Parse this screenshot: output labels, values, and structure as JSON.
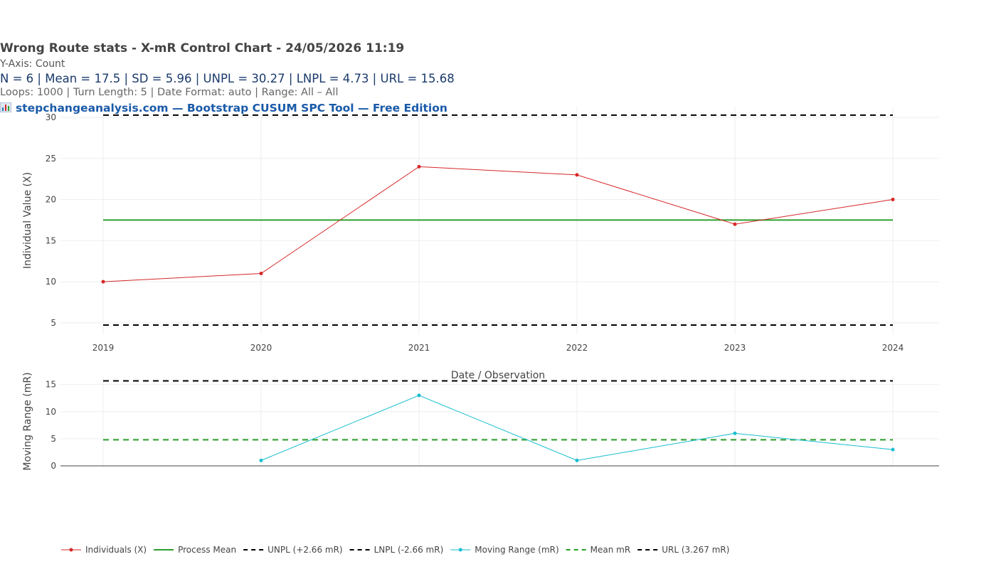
{
  "header": {
    "title": "Wrong Route stats - X-mR Control Chart - 24/05/2026 11:19",
    "y_axis_note": "Y-Axis: Count",
    "stats": "N = 6  |  Mean = 17.5  |  SD = 5.96  |  UNPL = 30.27  |  LNPL = 4.73  |  URL = 15.68",
    "meta": "Loops: 1000  |  Turn Length: 5  |  Date Format: auto  |  Range: All – All",
    "link": "stepchangeanalysis.com — Bootstrap CUSUM SPC Tool — Free Edition",
    "link_icon": "bar-chart-icon"
  },
  "chart_data": [
    {
      "type": "line",
      "name_ref": "individuals",
      "x": [
        "2019",
        "2020",
        "2021",
        "2022",
        "2023",
        "2024"
      ],
      "series": [
        {
          "name": "Individuals (X)",
          "values": [
            10,
            11,
            24,
            23,
            17,
            20
          ],
          "color": "#d62728",
          "markers": true
        }
      ],
      "reference_lines": [
        {
          "name": "Process Mean",
          "value": 17.5,
          "color": "#2ca02c",
          "dash": "solid"
        },
        {
          "name": "UNPL (+2.66 mR)",
          "value": 30.27,
          "color": "#000000",
          "dash": "dashed"
        },
        {
          "name": "LNPL (-2.66 mR)",
          "value": 4.73,
          "color": "#000000",
          "dash": "dashed"
        }
      ],
      "ylabel": "Individual Value (X)",
      "xlabel": "Date / Observation",
      "yticks": [
        5,
        10,
        15,
        20,
        25,
        30
      ],
      "ylim": [
        3.6,
        31.3
      ],
      "grid": true
    },
    {
      "type": "line",
      "name_ref": "moving-range",
      "x": [
        "2019",
        "2020",
        "2021",
        "2022",
        "2023",
        "2024"
      ],
      "series": [
        {
          "name": "Moving Range (mR)",
          "values": [
            null,
            1,
            13,
            1,
            6,
            3
          ],
          "color": "#17becf",
          "markers": true
        }
      ],
      "reference_lines": [
        {
          "name": "Mean mR",
          "value": 4.8,
          "color": "#2ca02c",
          "dash": "dashed"
        },
        {
          "name": "URL (3.267 mR)",
          "value": 15.68,
          "color": "#000000",
          "dash": "dashed"
        }
      ],
      "ylabel": "Moving Range (mR)",
      "yticks": [
        0,
        5,
        10,
        15
      ],
      "ylim": [
        0,
        16.4
      ],
      "grid": true
    }
  ],
  "legend": {
    "placement": "bottom",
    "items": [
      {
        "label": "Individuals (X)",
        "color": "#d62728",
        "style": "line-marker"
      },
      {
        "label": "Process Mean",
        "color": "#2ca02c",
        "style": "solid"
      },
      {
        "label": "UNPL (+2.66 mR)",
        "color": "#000000",
        "style": "dashed"
      },
      {
        "label": "LNPL (-2.66 mR)",
        "color": "#000000",
        "style": "dashed"
      },
      {
        "label": "Moving Range (mR)",
        "color": "#17becf",
        "style": "line-marker"
      },
      {
        "label": "Mean mR",
        "color": "#2ca02c",
        "style": "dashed"
      },
      {
        "label": "URL (3.267 mR)",
        "color": "#000000",
        "style": "dashed"
      }
    ]
  }
}
